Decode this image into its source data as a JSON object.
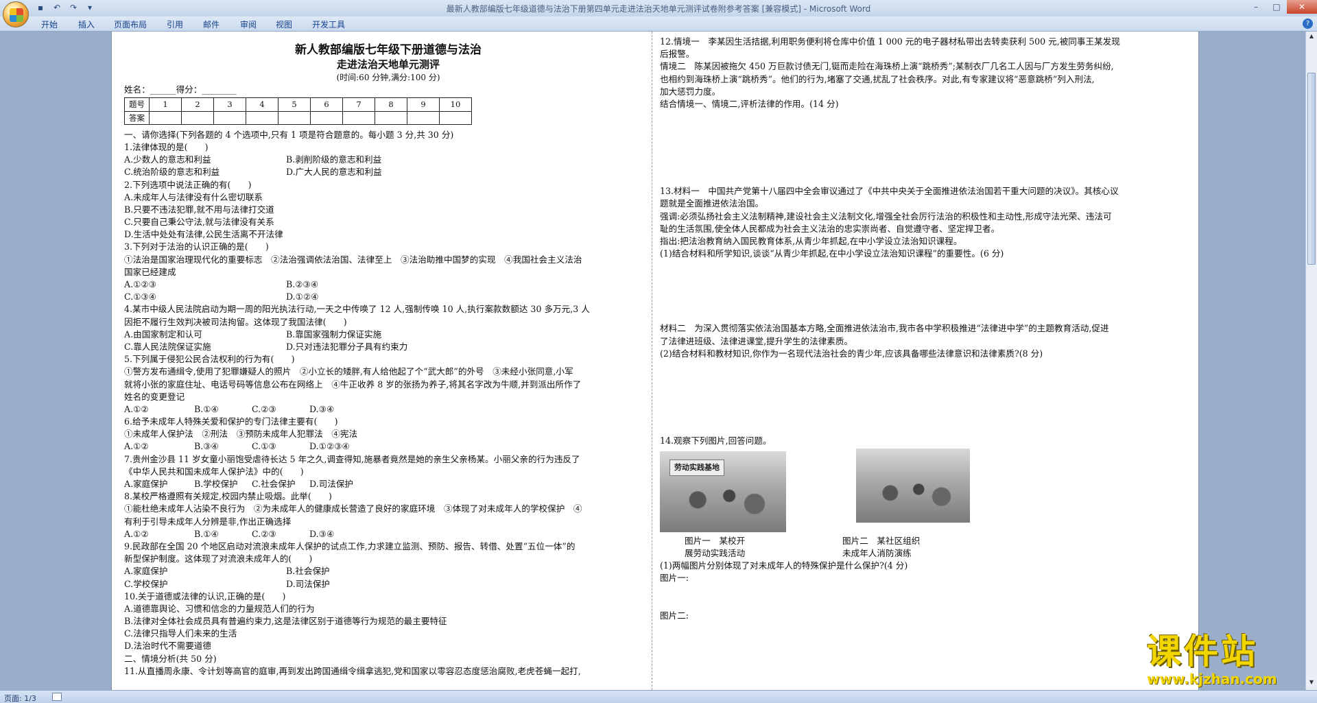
{
  "window": {
    "title": "最新人教部编版七年级道德与法治下册第四单元走进法治天地单元测评试卷附参考答案 [兼容模式] - Microsoft Word"
  },
  "ribbon": {
    "tabs": [
      "开始",
      "插入",
      "页面布局",
      "引用",
      "邮件",
      "审阅",
      "视图",
      "开发工具"
    ]
  },
  "status": {
    "page": "页面: 1/3"
  },
  "watermark": {
    "text": "课件站",
    "url": "www.kjzhan.com"
  },
  "doc": {
    "title": "新人教部编版七年级下册道德与法治",
    "subtitle": "走进法治天地单元测评",
    "note": "(时间:60 分钟,满分:100 分)",
    "name_line": "姓名：______得分：________",
    "table": {
      "row1_head": "题号",
      "row2_head": "答案",
      "numbers": [
        "1",
        "2",
        "3",
        "4",
        "5",
        "6",
        "7",
        "8",
        "9",
        "10"
      ]
    },
    "left_lines": [
      "一、请你选择(下列各题的 4 个选项中,只有 1 项是符合题意的。每小题 3 分,共 30 分)",
      "1.法律体现的是(　　)",
      [
        "A.少数人的意志和利益",
        "B.剥削阶级的意志和利益"
      ],
      [
        "C.统治阶级的意志和利益",
        "D.广大人民的意志和利益"
      ],
      "2.下列选项中说法正确的有(　　)",
      "A.未成年人与法律没有什么密切联系",
      "B.只要不违法犯罪,就不用与法律打交道",
      "C.只要自己秉公守法,就与法律没有关系",
      "D.生活中处处有法律,公民生活离不开法律",
      "3.下列对于法治的认识正确的是(　　)",
      "①法治是国家治理现代化的重要标志　②法治强调依法治国、法律至上　③法治助推中国梦的实现　④我国社会主义法治",
      "国家已经建成",
      [
        "A.①②③",
        "B.②③④"
      ],
      [
        "C.①③④",
        "D.①②④"
      ],
      "4.某市中级人民法院启动为期一周的阳光执法行动,一天之中传唤了 12 人,强制传唤 10 人,执行案款数额达 30 多万元,3 人",
      "因拒不履行生效判决被司法拘留。这体现了我国法律(　　)",
      [
        "A.由国家制定和认可",
        "B.靠国家强制力保证实施"
      ],
      [
        "C.靠人民法院保证实施",
        "D.只对违法犯罪分子具有约束力"
      ],
      "5.下列属于侵犯公民合法权利的行为有(　　)",
      "①警方发布通缉令,使用了犯罪嫌疑人的照片　②小立长的矮胖,有人给他起了个“武大郎”的外号　③未经小张同意,小军",
      "就将小张的家庭住址、电话号码等信息公布在网络上　④牛正收养 8 岁的张扬为养子,将其名字改为牛顺,并到派出所作了",
      "姓名的变更登记",
      [
        "A.①②",
        "B.①④",
        "C.②③",
        "D.③④"
      ],
      "6.给予未成年人特殊关爱和保护的专门法律主要有(　　)",
      "①未成年人保护法　②刑法　③预防未成年人犯罪法　④宪法",
      [
        "A.①②",
        "B.③④",
        "C.①③",
        "D.①②③④"
      ],
      "7.贵州金沙县 11 岁女童小丽饱受虐待长达 5 年之久,调查得知,施暴者竟然是她的亲生父亲杨某。小丽父亲的行为违反了",
      "《中华人民共和国未成年人保护法》中的(　　)",
      [
        "A.家庭保护",
        "B.学校保护",
        "C.社会保护",
        "D.司法保护"
      ],
      "8.某校严格遵照有关规定,校园内禁止吸烟。此举(　　)",
      "①能杜绝未成年人沾染不良行为　②为未成年人的健康成长营造了良好的家庭环境　③体现了对未成年人的学校保护　④",
      "有利于引导未成年人分辨是非,作出正确选择",
      [
        "A.①②",
        "B.①④",
        "C.②③",
        "D.③④"
      ],
      "9.民政部在全国 20 个地区启动对流浪未成年人保护的试点工作,力求建立监测、预防、报告、转借、处置“五位一体”的",
      "新型保护制度。这体现了对流浪未成年人的(　　)",
      [
        "A.家庭保护",
        "B.社会保护"
      ],
      [
        "C.学校保护",
        "D.司法保护"
      ],
      "10.关于道德或法律的认识,正确的是(　　)",
      "A.道德靠舆论、习惯和信念的力量规范人们的行为",
      "B.法律对全体社会成员具有普遍约束力,这是法律区别于道德等行为规范的最主要特征",
      "C.法律只指导人们未来的生活",
      "D.法治时代不需要道德",
      "二、情境分析(共 50 分)",
      "11.从直播周永康、令计划等高官的庭审,再到发出跨国通缉令缉拿逃犯,党和国家以零容忍态度惩治腐败,老虎苍蝇一起打,"
    ],
    "right": {
      "q12": [
        "12.情境一　李某因生活拮据,利用职务便利将仓库中价值 1 000 元的电子器材私带出去转卖获利 500 元,被同事王某发现",
        "后报警。",
        "情境二　陈某因被拖欠 450 万巨款讨债无门,铤而走险在海珠桥上演“跳桥秀”;某制衣厂几名工人因与厂方发生劳务纠纷,",
        "也相约到海珠桥上演“跳桥秀”。他们的行为,堵塞了交通,扰乱了社会秩序。对此,有专家建议将“恶意跳桥”列入刑法,",
        "加大惩罚力度。",
        "结合情境一、情境二,评析法律的作用。(14 分)"
      ],
      "q13": [
        "13.材料一　中国共产党第十八届四中全会审议通过了《中共中央关于全面推进依法治国若干重大问题的决议》。其核心议",
        "题就是全面推进依法治国。",
        "强调:必须弘扬社会主义法制精神,建设社会主义法制文化,增强全社会厉行法治的积极性和主动性,形成守法光荣、违法可",
        "耻的生活氛围,使全体人民都成为社会主义法治的忠实崇尚者、自觉遵守者、坚定捍卫者。",
        "指出:把法治教育纳入国民教育体系,从青少年抓起,在中小学设立法治知识课程。",
        "(1)结合材料和所学知识,谈谈“从青少年抓起,在中小学设立法治知识课程”的重要性。(6 分)"
      ],
      "q13b": [
        "材料二　为深入贯彻落实依法治国基本方略,全面推进依法治市,我市各中学积极推进“法律进中学”的主题教育活动,促进",
        "了法律进班级、法律进课堂,提升学生的法律素质。",
        "(2)结合材料和教材知识,你作为一名现代法治社会的青少年,应该具备哪些法律意识和法律素质?(8 分)"
      ],
      "q14": "14.观察下列图片,回答问题。",
      "photo1_sign": "劳动实践基地",
      "cap1a": "图片一　某校开",
      "cap1b": "展劳动实践活动",
      "cap2a": "图片二　某社区组织",
      "cap2b": "未成年人消防演练",
      "q14_1": "(1)两幅图片分别体现了对未成年人的特殊保护是什么保护?(4 分)",
      "ans1": "图片一:",
      "ans2": "图片二:"
    }
  }
}
